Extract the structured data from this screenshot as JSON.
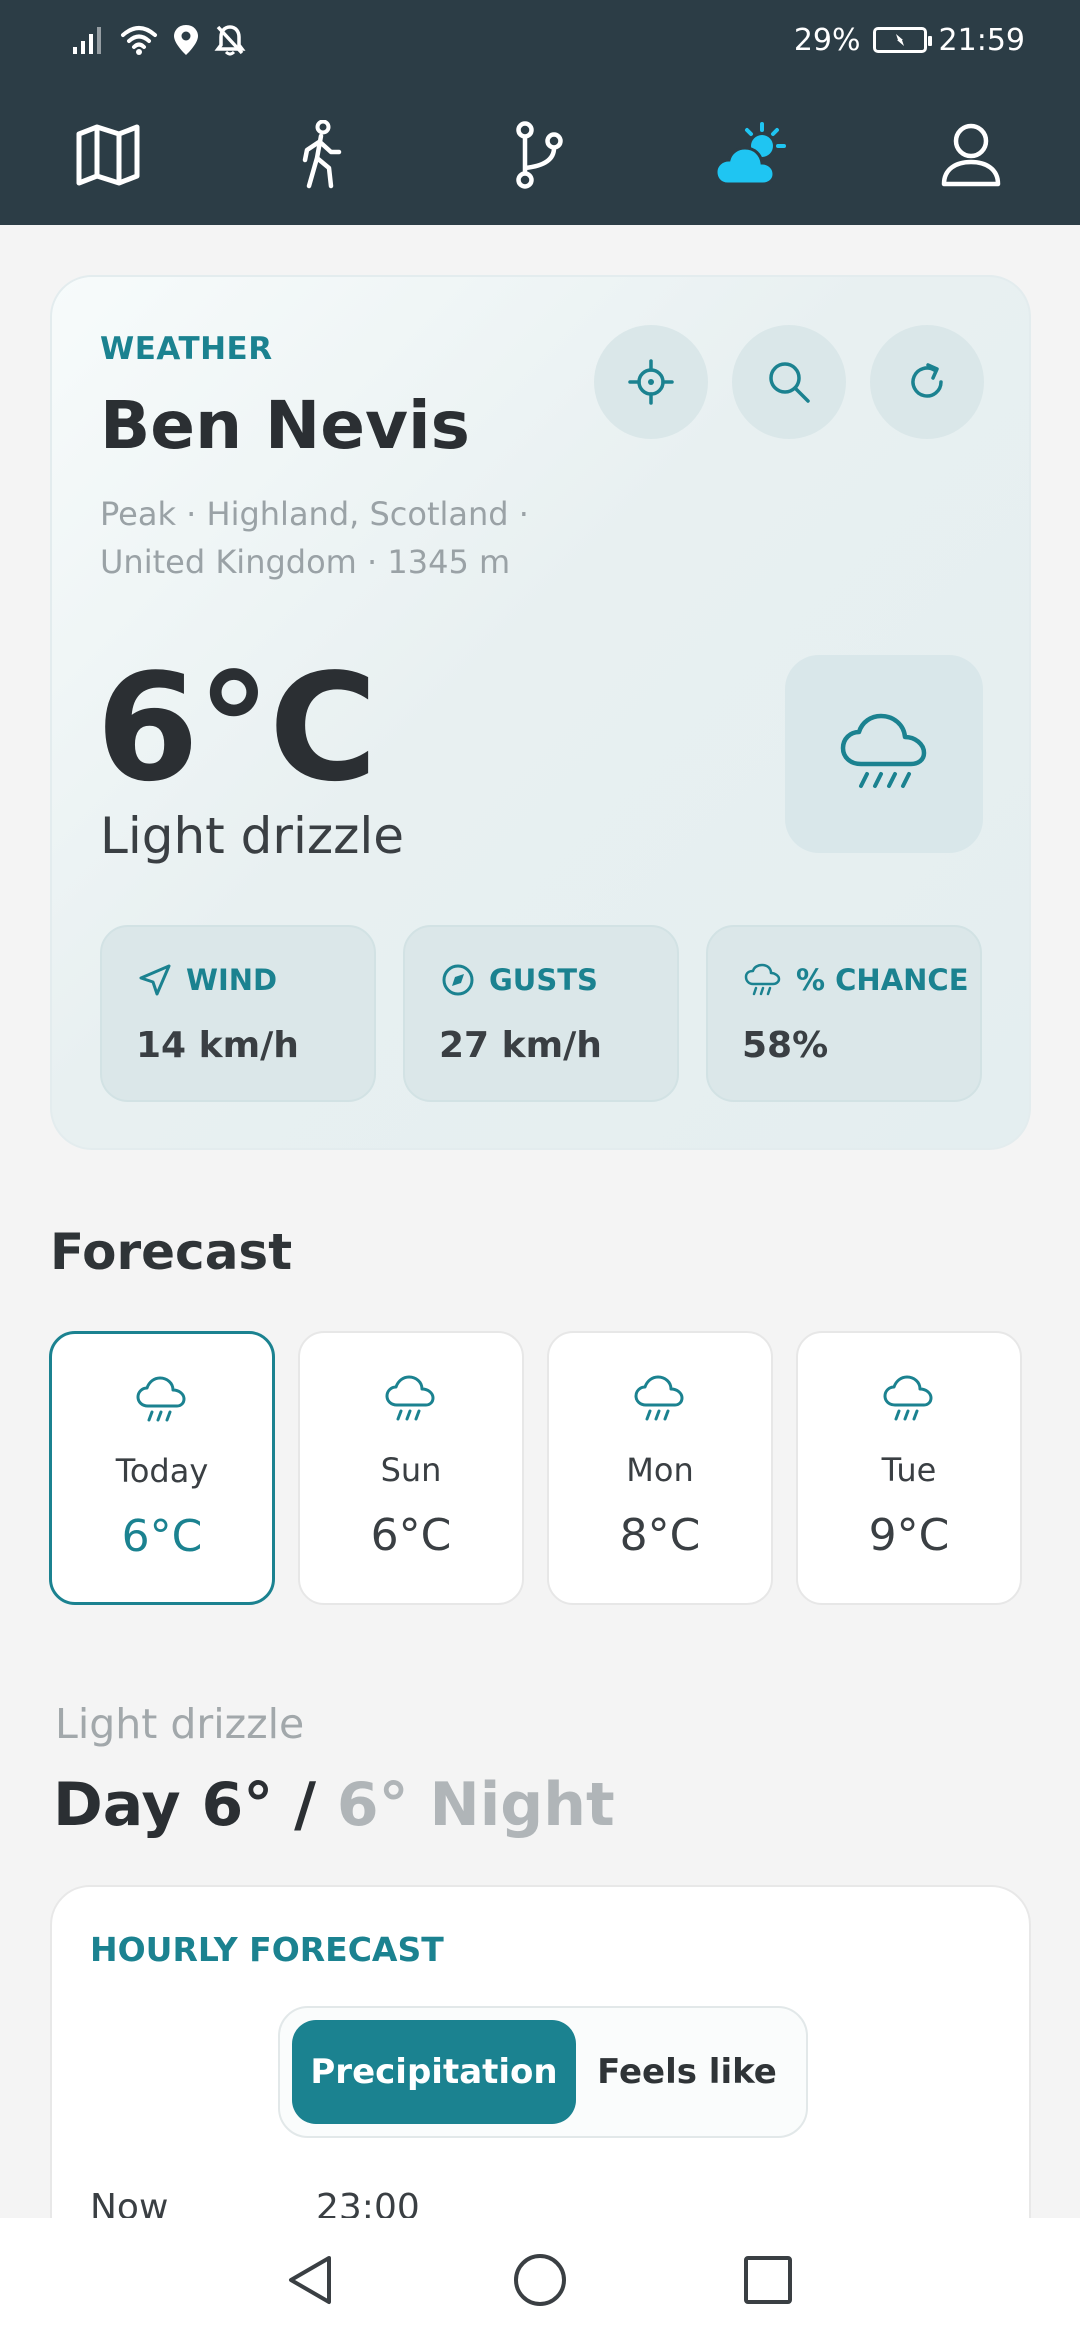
{
  "status_bar": {
    "battery": "29%",
    "time": "21:59"
  },
  "nav": {
    "items": [
      {
        "icon": "map-icon",
        "active": false
      },
      {
        "icon": "hiker-icon",
        "active": false
      },
      {
        "icon": "route-icon",
        "active": false
      },
      {
        "icon": "weather-icon",
        "active": true
      },
      {
        "icon": "profile-icon",
        "active": false
      }
    ],
    "active_color": "#1fc5f2"
  },
  "weather_card": {
    "kicker": "WEATHER",
    "location": "Ben Nevis",
    "subtitle_line1": "Peak · Highland, Scotland ·",
    "subtitle_line2": "United Kingdom · 1345 m",
    "temperature": "6°C",
    "condition": "Light drizzle",
    "actions": [
      "locate-icon",
      "search-icon",
      "refresh-icon"
    ],
    "stats": [
      {
        "label": "WIND",
        "value": "14 km/h",
        "icon": "navigation-arrow-icon"
      },
      {
        "label": "GUSTS",
        "value": "27 km/h",
        "icon": "compass-icon"
      },
      {
        "label": "% CHANCE",
        "value": "58%",
        "icon": "rain-cloud-icon"
      }
    ]
  },
  "forecast": {
    "title": "Forecast",
    "days": [
      {
        "name": "Today",
        "temp": "6°C",
        "selected": true
      },
      {
        "name": "Sun",
        "temp": "6°C",
        "selected": false
      },
      {
        "name": "Mon",
        "temp": "8°C",
        "selected": false
      },
      {
        "name": "Tue",
        "temp": "9°C",
        "selected": false
      }
    ]
  },
  "summary": {
    "condition": "Light drizzle",
    "day": "Day 6° /",
    "night": "6° Night"
  },
  "hourly": {
    "title": "HOURLY FORECAST",
    "tabs": [
      "Precipitation",
      "Feels like"
    ],
    "active_tab": "Precipitation",
    "hours": [
      "Now",
      "23:00"
    ]
  },
  "colors": {
    "accent": "#1b8290",
    "header_bg": "#2c3d46"
  }
}
